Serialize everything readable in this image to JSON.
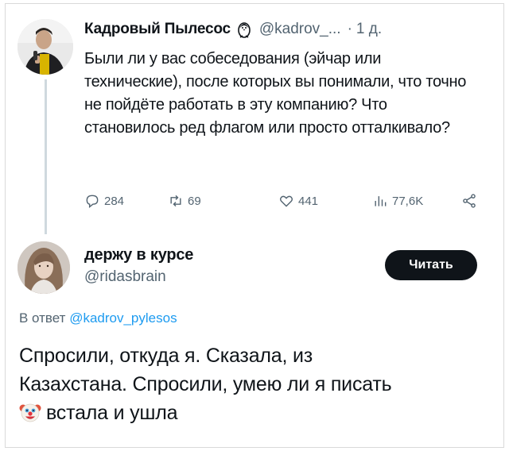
{
  "tweet": {
    "author_name": "Кадровый Пылесос",
    "author_badge_icon": "penguin-icon",
    "author_handle": "@kadrov_...",
    "separator": "·",
    "time": "1 д.",
    "text": "Были ли у вас собеседования (эйчар или технические), после которых вы понимали, что точно не пойдёте работать в эту компанию? Что становилось ред флагом или просто отталкивало?",
    "stats": {
      "replies": "284",
      "reposts": "69",
      "likes": "441",
      "views": "77,6K"
    },
    "icons": [
      "reply-icon",
      "repost-icon",
      "like-icon",
      "views-icon",
      "share-icon"
    ]
  },
  "reply": {
    "author_name": "держу в курсе",
    "author_handle": "@ridasbrain",
    "follow_label": "Читать",
    "reply_prefix": "В ответ",
    "reply_mention": "@kadrov_pylesos",
    "text_line1": "Спросили, откуда я. Сказала, из",
    "text_line2": "Казахстана. Спросили, умею ли я писать",
    "text_line3": "встала и ушла",
    "emoji_icon": "clown-face-icon"
  },
  "colors": {
    "text": "#0f1419",
    "secondary": "#536471",
    "link": "#1d9bf0",
    "button_bg": "#0f1419",
    "thread_line": "#cfd9de"
  }
}
